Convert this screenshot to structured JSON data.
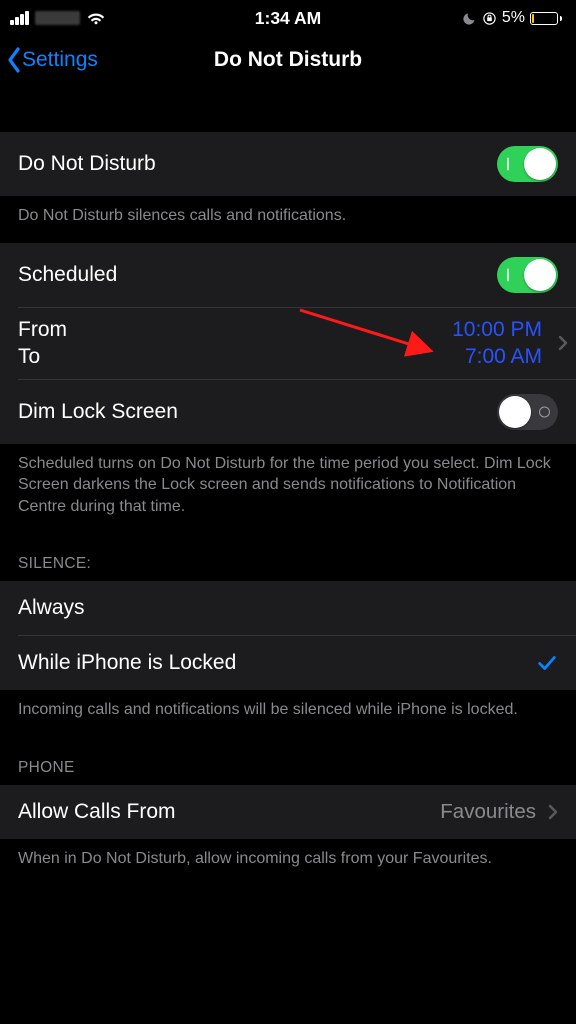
{
  "status": {
    "time": "1:34 AM",
    "battery_pct": "5%"
  },
  "nav": {
    "back_label": "Settings",
    "title": "Do Not Disturb"
  },
  "dnd": {
    "label": "Do Not Disturb",
    "footer": "Do Not Disturb silences calls and notifications."
  },
  "scheduled": {
    "label": "Scheduled",
    "from_label": "From",
    "to_label": "To",
    "from_time": "10:00 PM",
    "to_time": "7:00 AM",
    "dim_label": "Dim Lock Screen",
    "footer": "Scheduled turns on Do Not Disturb for the time period you select. Dim Lock Screen darkens the Lock screen and sends notifications to Notification Centre during that time."
  },
  "silence": {
    "header": "SILENCE:",
    "always": "Always",
    "locked": "While iPhone is Locked",
    "footer": "Incoming calls and notifications will be silenced while iPhone is locked."
  },
  "phone": {
    "header": "PHONE",
    "allow_label": "Allow Calls From",
    "allow_value": "Favourites",
    "footer": "When in Do Not Disturb, allow incoming calls from your Favourites."
  }
}
